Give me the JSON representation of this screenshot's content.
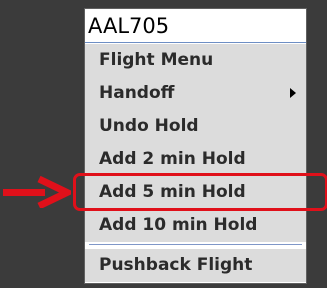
{
  "menu": {
    "title": "AAL705",
    "items": [
      {
        "label": "Flight Menu",
        "has_submenu": false
      },
      {
        "label": "Handoff",
        "has_submenu": true
      },
      {
        "label": "Undo Hold",
        "has_submenu": false
      },
      {
        "label": "Add 2 min Hold",
        "has_submenu": false
      },
      {
        "label": "Add 5 min Hold",
        "has_submenu": false,
        "highlighted": true
      },
      {
        "label": "Add 10 min Hold",
        "has_submenu": false
      },
      {
        "label": "Pushback Flight",
        "has_submenu": false
      }
    ]
  },
  "annotation": {
    "color": "#e0101a"
  },
  "colors": {
    "background": "#3b3b3b",
    "menu_item_bg": "#dcdcdc",
    "separator": "#7f97c8"
  }
}
